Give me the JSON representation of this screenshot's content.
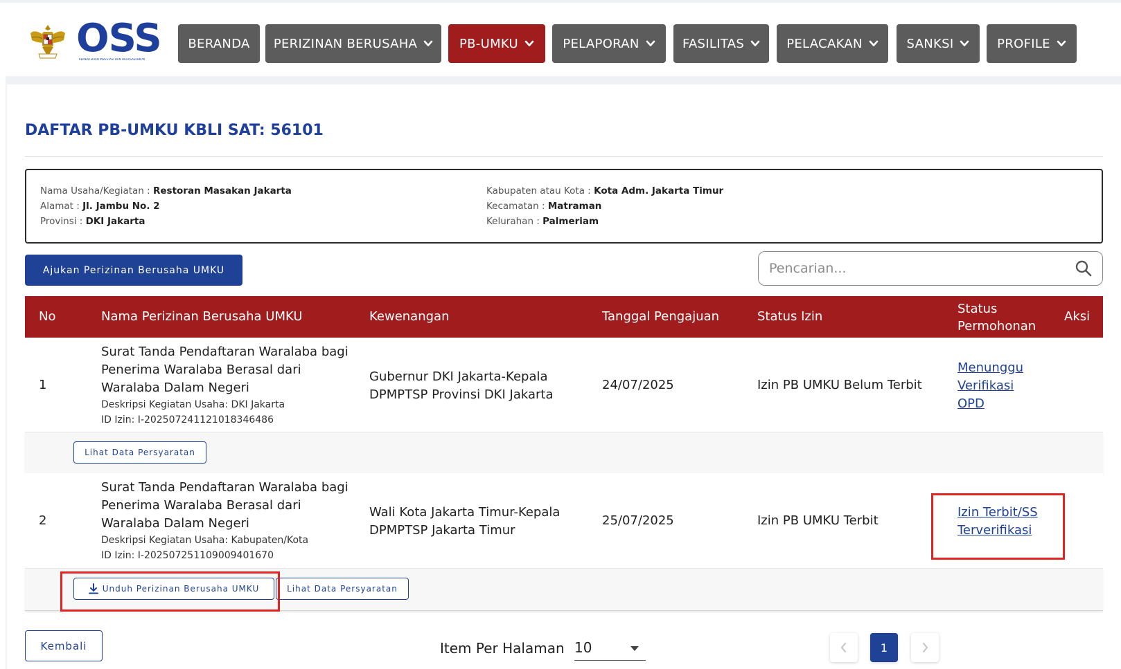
{
  "logo": {
    "brand": "OSS",
    "tagline": "KEMENTERIAN INVESTASI DAN HILIRISASI/BKPM"
  },
  "nav": [
    {
      "label": "BERANDA",
      "dropdown": false,
      "active": false
    },
    {
      "label": "PERIZINAN BERUSAHA",
      "dropdown": true,
      "active": false
    },
    {
      "label": "PB-UMKU",
      "dropdown": true,
      "active": true
    },
    {
      "label": "PELAPORAN",
      "dropdown": true,
      "active": false
    },
    {
      "label": "FASILITAS",
      "dropdown": true,
      "active": false
    },
    {
      "label": "PELACAKAN",
      "dropdown": true,
      "active": false
    },
    {
      "label": "SANKSI",
      "dropdown": true,
      "active": false
    },
    {
      "label": "PROFILE",
      "dropdown": true,
      "active": false
    }
  ],
  "page": {
    "title": "DAFTAR PB-UMKU KBLI SAT: 56101"
  },
  "info": {
    "nama_label": "Nama Usaha/Kegiatan : ",
    "nama_value": "Restoran Masakan Jakarta",
    "alamat_label": "Alamat : ",
    "alamat_value": "Jl. Jambu No. 2",
    "provinsi_label": "Provinsi : ",
    "provinsi_value": "DKI Jakarta",
    "kab_label": "Kabupaten atau Kota : ",
    "kab_value": "Kota Adm. Jakarta Timur",
    "kec_label": "Kecamatan : ",
    "kec_value": "Matraman",
    "kel_label": "Kelurahan : ",
    "kel_value": "Palmeriam"
  },
  "actions": {
    "submit_label": "Ajukan Perizinan Berusaha UMKU"
  },
  "search": {
    "placeholder": "Pencarian..."
  },
  "table": {
    "headers": {
      "no": "No",
      "nama": "Nama Perizinan Berusaha UMKU",
      "kewenangan": "Kewenangan",
      "tanggal": "Tanggal Pengajuan",
      "status_izin": "Status Izin",
      "status_permohonan_1": "Status",
      "status_permohonan_2": "Permohonan",
      "aksi": "Aksi"
    },
    "rows": [
      {
        "no": "1",
        "nama_1": "Surat Tanda Pendaftaran Waralaba bagi",
        "nama_2": "Penerima Waralaba Berasal dari",
        "nama_3": "Waralaba Dalam Negeri",
        "deskripsi": "Deskripsi Kegiatan Usaha: DKI Jakarta",
        "id_izin": "ID Izin: I-202507241121018346486",
        "kewenangan_1": "Gubernur DKI Jakarta-Kepala",
        "kewenangan_2": "DPMPTSP Provinsi DKI Jakarta",
        "tanggal": "24/07/2025",
        "status_izin": "Izin PB UMKU Belum Terbit",
        "status_1": "Menunggu",
        "status_2": "Verifikasi",
        "status_3": "OPD",
        "lihat_label": "Lihat Data Persyaratan"
      },
      {
        "no": "2",
        "nama_1": "Surat Tanda Pendaftaran Waralaba bagi",
        "nama_2": "Penerima Waralaba Berasal dari",
        "nama_3": "Waralaba Dalam Negeri",
        "deskripsi": "Deskripsi Kegiatan Usaha: Kabupaten/Kota",
        "id_izin": "ID Izin: I-202507251109009401670",
        "kewenangan_1": "Wali Kota Jakarta Timur-Kepala",
        "kewenangan_2": "DPMPTSP Jakarta Timur",
        "tanggal": "25/07/2025",
        "status_izin": "Izin PB UMKU Terbit",
        "status_1": "Izin Terbit/SS",
        "status_2": "Terverifikasi",
        "unduh_label": "Unduh Perizinan Berusaha UMKU",
        "lihat_label": "Lihat Data Persyaratan"
      }
    ]
  },
  "footer": {
    "back_label": "Kembali",
    "per_page_label": "Item Per Halaman",
    "per_page_value": "10",
    "current_page": "1",
    "prev_icon": "chevron-left-icon",
    "next_icon": "chevron-right-icon"
  },
  "colors": {
    "primary": "#1f4196",
    "accent_red": "#a11c1c",
    "nav_gray": "#5c5c5c",
    "highlight": "#e02424"
  }
}
